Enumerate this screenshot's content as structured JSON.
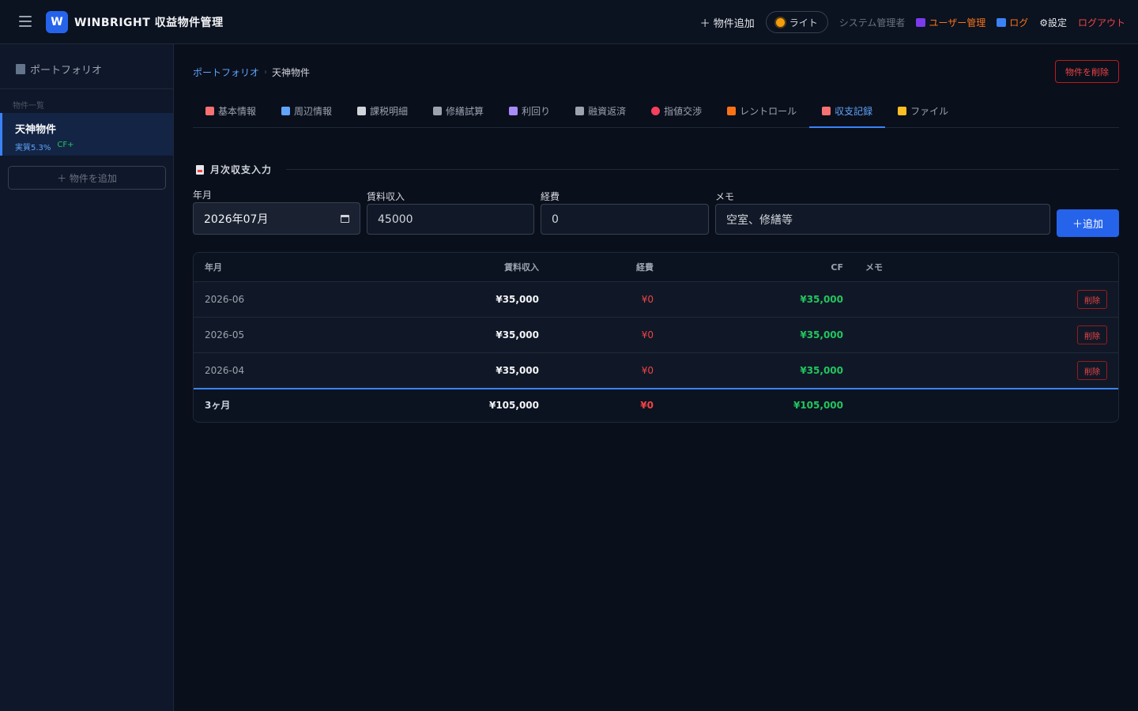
{
  "header": {
    "logo_letter": "W",
    "app_title": "WINBRIGHT 収益物件管理",
    "nav": {
      "add_property": "＋ 物件追加",
      "light_mode": "ライト",
      "admin_label": "システム管理者",
      "user_management": "ユーザー管理",
      "log": "ログ",
      "settings": "⚙設定",
      "logout": "ログアウト"
    }
  },
  "sidebar": {
    "title": "ポートフォリオ",
    "list_label": "物件一覧",
    "items": [
      {
        "name": "天神物件",
        "yield": "実質5.3%",
        "cf": "CF+"
      }
    ],
    "add_button": "＋ 物件を追加"
  },
  "breadcrumb": {
    "root": "ポートフォリオ",
    "separator": "›",
    "current": "天神物件"
  },
  "delete_property_button": "物件を削除",
  "tabs": [
    {
      "label": "基本情報",
      "icon": "clipboard-icon",
      "color": "#f87171"
    },
    {
      "label": "周辺情報",
      "icon": "map-icon",
      "color": "#60a5fa"
    },
    {
      "label": "課税明細",
      "icon": "scroll-icon",
      "color": "#d1d5db"
    },
    {
      "label": "修繕試算",
      "icon": "hammer-icon",
      "color": "#9ca3af"
    },
    {
      "label": "利回り",
      "icon": "bar-chart-icon",
      "color": "#a78bfa"
    },
    {
      "label": "融資返済",
      "icon": "bank-icon",
      "color": "#9ca3af"
    },
    {
      "label": "指値交渉",
      "icon": "target-icon",
      "color": "#f43f5e"
    },
    {
      "label": "レントロール",
      "icon": "house-icon",
      "color": "#f97316"
    },
    {
      "label": "収支記録",
      "icon": "document-icon",
      "color": "#f87171",
      "active": true
    },
    {
      "label": "ファイル",
      "icon": "folder-icon",
      "color": "#fbbf24"
    }
  ],
  "section": {
    "title": "月次収支入力"
  },
  "form": {
    "year_month": {
      "label": "年月",
      "value": "2026年07月"
    },
    "rent_income": {
      "label": "賃料収入",
      "value": "45000"
    },
    "expenses": {
      "label": "経費",
      "value": "0"
    },
    "memo": {
      "label": "メモ",
      "placeholder": "空室、修繕等"
    },
    "add_button": "＋追加"
  },
  "table": {
    "headers": {
      "year_month": "年月",
      "rent": "賃料収入",
      "expenses": "経費",
      "cf": "CF",
      "memo": "メモ"
    },
    "rows": [
      {
        "year_month": "2026-06",
        "rent": "¥35,000",
        "expenses": "¥0",
        "cf": "¥35,000",
        "memo": "",
        "delete": "削除"
      },
      {
        "year_month": "2026-05",
        "rent": "¥35,000",
        "expenses": "¥0",
        "cf": "¥35,000",
        "memo": "",
        "delete": "削除"
      },
      {
        "year_month": "2026-04",
        "rent": "¥35,000",
        "expenses": "¥0",
        "cf": "¥35,000",
        "memo": "",
        "delete": "削除"
      }
    ],
    "total": {
      "label": "3ヶ月",
      "rent": "¥105,000",
      "expenses": "¥0",
      "cf": "¥105,000"
    }
  },
  "colors": {
    "accent": "#2563eb",
    "positive": "#22c55e",
    "negative": "#ef4444",
    "warning": "#f97316"
  }
}
